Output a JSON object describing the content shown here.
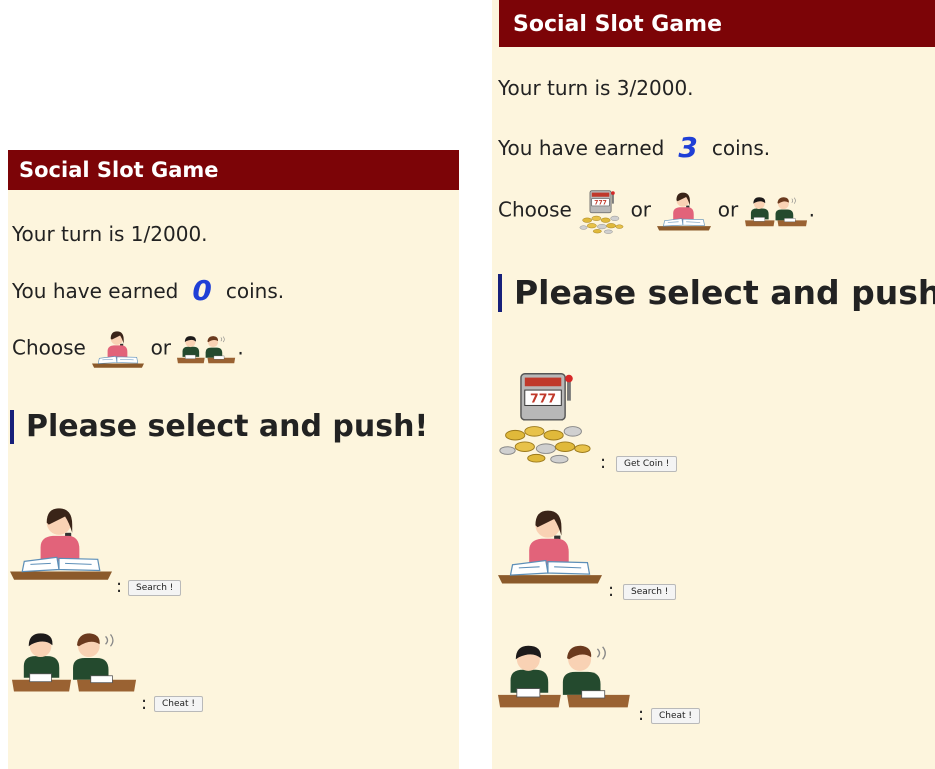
{
  "left": {
    "title": "Social Slot Game",
    "turn_text": "Your turn is 1/2000.",
    "earned_prefix": "You have earned",
    "coins": "0",
    "earned_suffix": "coins.",
    "choose_label": "Choose",
    "or_1": "or",
    "period": ".",
    "heading": "Please select and push!",
    "colon": ":",
    "options": [
      {
        "label": "Search !",
        "icon": "studying-girl-icon"
      },
      {
        "label": "Cheat !",
        "icon": "cheating-students-icon"
      }
    ]
  },
  "right": {
    "title": "Social Slot Game",
    "turn_text": "Your turn is 3/2000.",
    "earned_prefix": "You have earned",
    "coins": "3",
    "earned_suffix": "coins.",
    "choose_label": "Choose",
    "or_1": "or",
    "or_2": "or",
    "period": ".",
    "heading": "Please select and push!",
    "colon": ":",
    "options": [
      {
        "label": "Get Coin !",
        "icon": "slot-machine-icon"
      },
      {
        "label": "Search !",
        "icon": "studying-girl-icon"
      },
      {
        "label": "Cheat !",
        "icon": "cheating-students-icon"
      }
    ]
  },
  "colors": {
    "header": "#7c0407",
    "panel": "#fdf5dd",
    "coin": "#1f3fd6",
    "heading_bar": "#17207a"
  }
}
